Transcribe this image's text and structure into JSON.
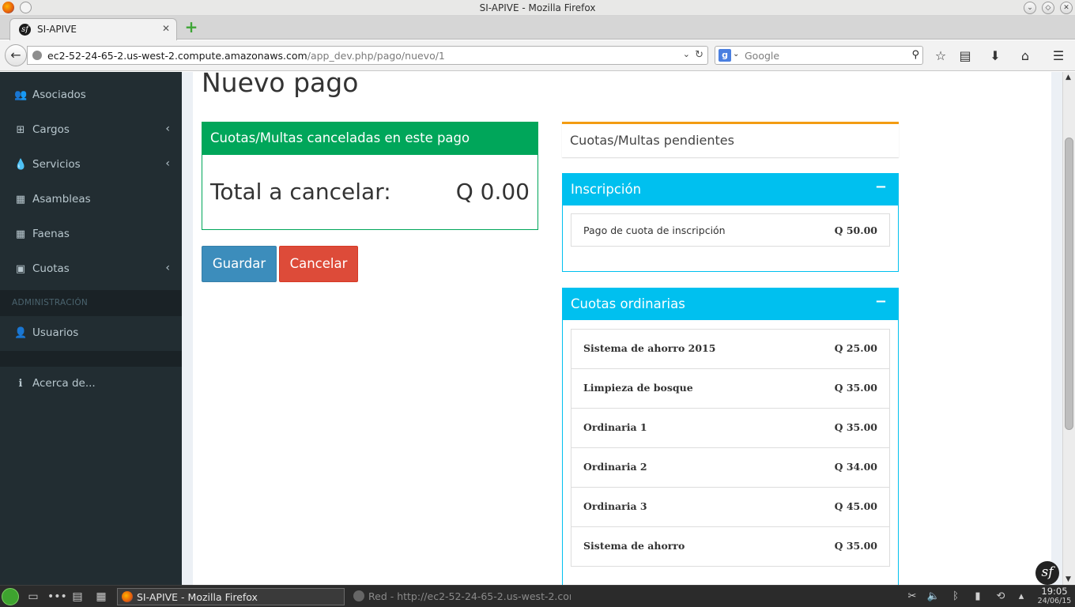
{
  "window": {
    "title": "SI-APIVE - Mozilla Firefox"
  },
  "tab": {
    "label": "SI-APIVE"
  },
  "urlbar": {
    "host": "ec2-52-24-65-2.us-west-2.compute.amazonaws.com",
    "path": "/app_dev.php/pago/nuevo/1"
  },
  "search": {
    "placeholder": "Google"
  },
  "sidebar": {
    "items": [
      {
        "label": "Asociados",
        "icon": "users-icon"
      },
      {
        "label": "Cargos",
        "icon": "sitemap-icon"
      },
      {
        "label": "Servicios",
        "icon": "tint-icon"
      },
      {
        "label": "Asambleas",
        "icon": "calendar-icon"
      },
      {
        "label": "Faenas",
        "icon": "calendar-icon"
      },
      {
        "label": "Cuotas",
        "icon": "money-icon"
      }
    ],
    "section_header": "ADMINISTRACIÓN",
    "admin_items": [
      {
        "label": "Usuarios",
        "icon": "user-icon"
      }
    ],
    "footer_items": [
      {
        "label": "Acerca de...",
        "icon": "info-icon"
      }
    ]
  },
  "page": {
    "title": "Nuevo pago"
  },
  "paid_box": {
    "title": "Cuotas/Multas canceladas en este pago",
    "total_label": "Total a cancelar:",
    "total_value": "Q 0.00"
  },
  "buttons": {
    "save": "Guardar",
    "cancel": "Cancelar"
  },
  "pending_box": {
    "title": "Cuotas/Multas pendientes"
  },
  "groups": [
    {
      "title": "Inscripción",
      "collapse": "−",
      "items": [
        {
          "name": "Pago de cuota de inscripción",
          "amount": "Q 50.00"
        }
      ]
    },
    {
      "title": "Cuotas ordinarias",
      "collapse": "−",
      "items": [
        {
          "name": "Sistema de ahorro 2015",
          "amount": "Q 25.00"
        },
        {
          "name": "Limpieza de bosque",
          "amount": "Q 35.00"
        },
        {
          "name": "Ordinaria 1",
          "amount": "Q 35.00"
        },
        {
          "name": "Ordinaria 2",
          "amount": "Q 34.00"
        },
        {
          "name": "Ordinaria 3",
          "amount": "Q 45.00"
        },
        {
          "name": "Sistema de ahorro",
          "amount": "Q 35.00"
        }
      ]
    }
  ],
  "taskbar": {
    "active_task": "SI-APIVE - Mozilla Firefox",
    "inactive_task": "Red - http://ec2-52-24-65-2.us-west-2.com",
    "time": "19:05",
    "date": "24/06/15"
  },
  "colors": {
    "sidebar_bg": "#222d32",
    "success": "#00a65a",
    "info": "#00c0ef",
    "warning": "#f39c12",
    "primary": "#3c8dbc",
    "danger": "#dd4b39"
  }
}
